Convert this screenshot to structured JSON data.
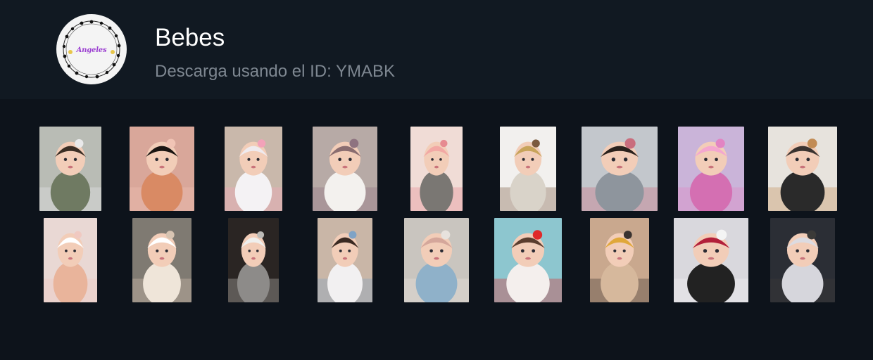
{
  "pack": {
    "title": "Bebes",
    "subtitle": "Descarga usando el ID: YMABK",
    "avatar_text": "Angeles",
    "avatar_icon": "flower-wreath-icon"
  },
  "colors": {
    "background": "#0d131b",
    "header": "#111922",
    "title": "#ffffff",
    "subtitle": "#7e8791"
  },
  "stickers": [
    {
      "bg": "#b9bcb5",
      "cloth": "#6f7a62",
      "hair": "#3a2e25",
      "accent": "#e9e9ea"
    },
    {
      "bg": "#d9a79a",
      "cloth": "#d98a64",
      "hair": "#1a1512",
      "accent": "#f1c4b5"
    },
    {
      "bg": "#c9b8ab",
      "cloth": "#f4f2f4",
      "hair": "#efeaee",
      "accent": "#f3a2b9"
    },
    {
      "bg": "#b7aaa6",
      "cloth": "#f3f1ee",
      "hair": "#8a6d70",
      "accent": "#8e7380"
    },
    {
      "bg": "#f0dcd6",
      "cloth": "#7a7773",
      "hair": "#f2a8a4",
      "accent": "#e68a91"
    },
    {
      "bg": "#f2f0ee",
      "cloth": "#d9d3c9",
      "hair": "#c8a45b",
      "accent": "#7b5a3e"
    },
    {
      "bg": "#c3c7cc",
      "cloth": "#8e959d",
      "hair": "#2a211c",
      "accent": "#c96d7d"
    },
    {
      "bg": "#cab4d9",
      "cloth": "#d46fb2",
      "hair": "#f4a7cf",
      "accent": "#e284c3"
    },
    {
      "bg": "#e7e3dd",
      "cloth": "#2a2a2a",
      "hair": "#3a3330",
      "accent": "#c28c55"
    },
    {
      "bg": "#e9d8d4",
      "cloth": "#e9b49b",
      "hair": "#ffffff",
      "accent": "#f0c9c1"
    },
    {
      "bg": "#7f7a72",
      "cloth": "#efe5d9",
      "hair": "#ffffff",
      "accent": "#d8c4b2"
    },
    {
      "bg": "#2a2523",
      "cloth": "#8d8b89",
      "hair": "#efefed",
      "accent": "#bdbbb7"
    },
    {
      "bg": "#c9b6a7",
      "cloth": "#f2f0f1",
      "hair": "#3b2a22",
      "accent": "#7ea3c6"
    },
    {
      "bg": "#c9c5bf",
      "cloth": "#8fb1c9",
      "hair": "#d5a79b",
      "accent": "#e7e2dd"
    },
    {
      "bg": "#8dc6cf",
      "cloth": "#f4efed",
      "hair": "#5a3d2e",
      "accent": "#e02a2a"
    },
    {
      "bg": "#c9a88e",
      "cloth": "#d6b89c",
      "hair": "#e0a83a",
      "accent": "#3a3330"
    },
    {
      "bg": "#d9d8dd",
      "cloth": "#222222",
      "hair": "#b3203a",
      "accent": "#f4f4f4"
    },
    {
      "bg": "#2b2e35",
      "cloth": "#d6d6dc",
      "hair": "#dcdbe1",
      "accent": "#3b3a38"
    }
  ]
}
